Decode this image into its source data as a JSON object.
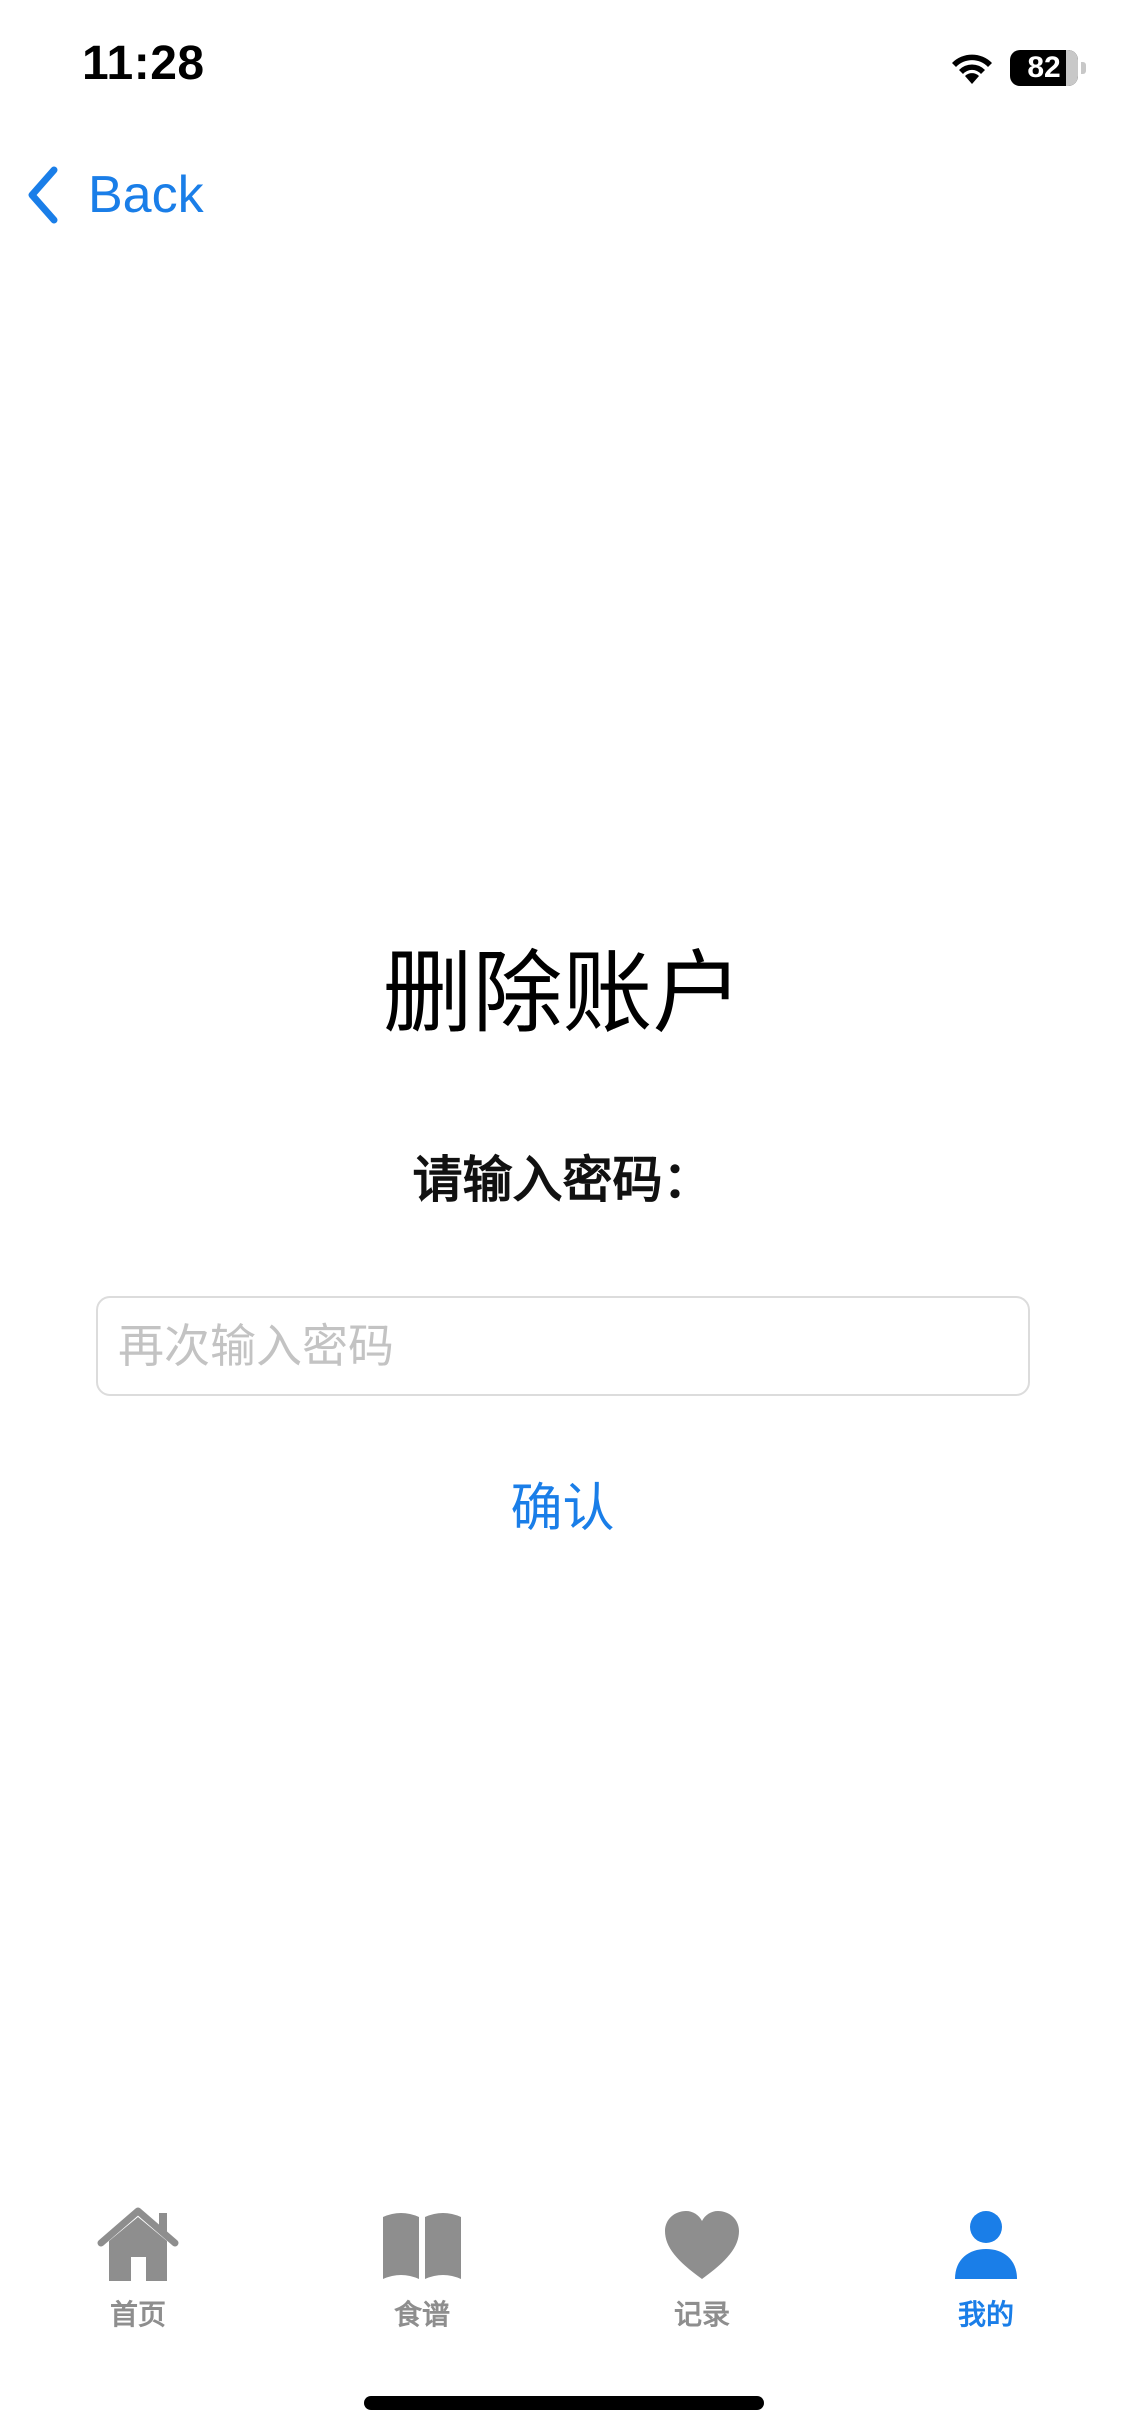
{
  "status_bar": {
    "time": "11:28",
    "battery_level": 82,
    "battery_text": "82"
  },
  "nav": {
    "back_label": "Back"
  },
  "main": {
    "title": "删除账户",
    "prompt": "请输入密码：",
    "password_placeholder": "再次输入密码",
    "confirm_label": "确认"
  },
  "tab_bar": {
    "items": [
      {
        "label": "首页",
        "icon": "house-icon",
        "active": false
      },
      {
        "label": "食谱",
        "icon": "book-icon",
        "active": false
      },
      {
        "label": "记录",
        "icon": "heart-icon",
        "active": false
      },
      {
        "label": "我的",
        "icon": "person-icon",
        "active": true
      }
    ]
  },
  "colors": {
    "accent": "#1a7ee8",
    "tab_inactive": "#8e8e8e",
    "placeholder": "#c3c3c3"
  }
}
